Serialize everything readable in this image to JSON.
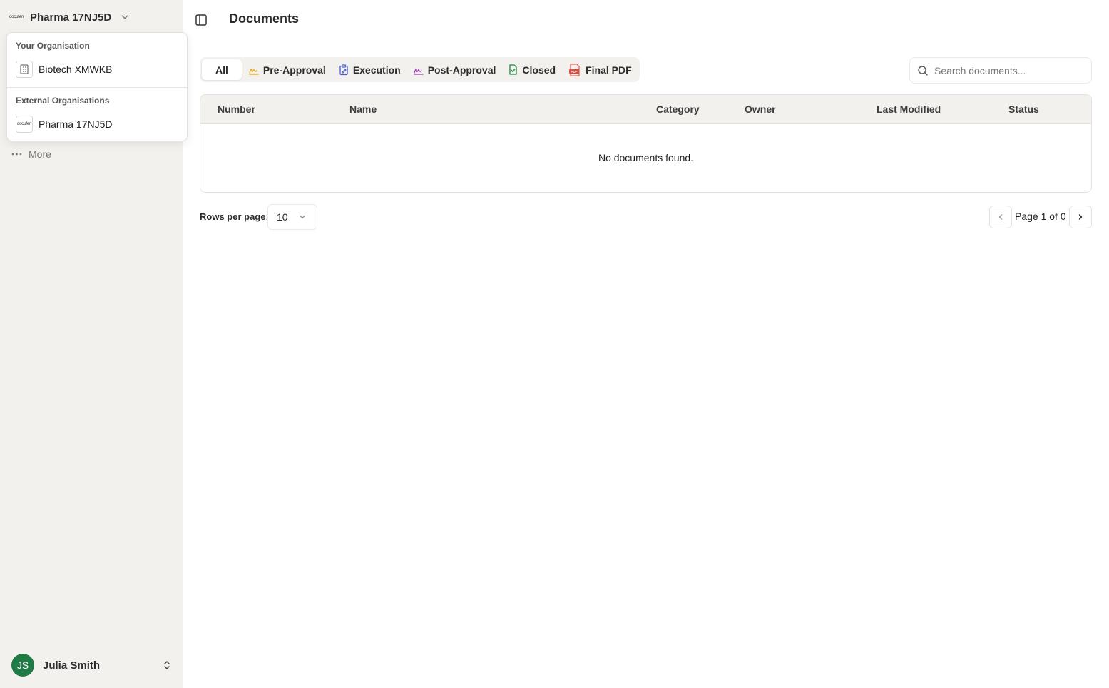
{
  "sidebar": {
    "org_switcher": {
      "name": "Pharma 17NJ5D",
      "logo_text": "docufen"
    },
    "more_label": "More",
    "user": {
      "initials": "JS",
      "name": "Julia Smith",
      "avatar_color": "#1f7a45"
    }
  },
  "org_dropdown": {
    "your_org_label": "Your Organisation",
    "your_org": {
      "name": "Biotech XMWKB",
      "icon": "building-icon"
    },
    "external_label": "External Organisations",
    "external_orgs": [
      {
        "name": "Pharma 17NJ5D",
        "logo_text": "docufen"
      }
    ]
  },
  "header": {
    "title": "Documents"
  },
  "tabs": [
    {
      "label": "All",
      "active": true,
      "icon": ""
    },
    {
      "label": "Pre-Approval",
      "icon": "signature-icon",
      "color": "#e8a317"
    },
    {
      "label": "Execution",
      "icon": "clipboard-pen-icon",
      "color": "#4a5bd6"
    },
    {
      "label": "Post-Approval",
      "icon": "signature-icon",
      "color": "#9b3fb5"
    },
    {
      "label": "Closed",
      "icon": "file-check-icon",
      "color": "#1f8a45"
    },
    {
      "label": "Final PDF",
      "icon": "pdf-icon",
      "color": "#e04b3a"
    }
  ],
  "search": {
    "placeholder": "Search documents...",
    "value": ""
  },
  "table": {
    "columns": [
      "Number",
      "Name",
      "Category",
      "Owner",
      "Last Modified",
      "Status"
    ],
    "rows": [],
    "empty_message": "No documents found."
  },
  "pagination": {
    "rows_per_page_label": "Rows per page:",
    "rows_per_page": "10",
    "page_text": "Page 1 of 0"
  }
}
